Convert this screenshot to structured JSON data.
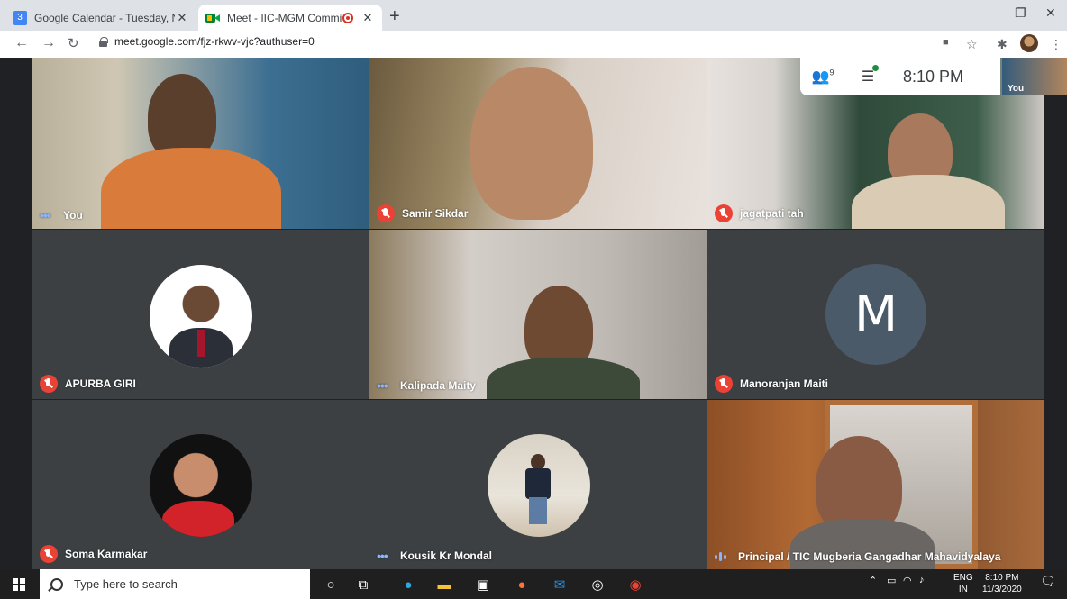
{
  "browser": {
    "tabs": [
      {
        "title": "Google Calendar - Tuesday, Nov",
        "favicon": "calendar-icon",
        "favicon_text": "3"
      },
      {
        "title": "Meet - IIC-MGM Committee",
        "favicon": "meet-icon",
        "recording": true
      }
    ],
    "url": "meet.google.com/fjz-rkwv-vjc?authuser=0",
    "new_tab": "+"
  },
  "meet": {
    "clock": "8:10 PM",
    "participants_badge": "9",
    "self_label": "You",
    "tiles": [
      {
        "name": "You",
        "state": "speaking-dots"
      },
      {
        "name": "Samir Sikdar",
        "state": "muted"
      },
      {
        "name": "jagatpati tah",
        "state": "muted"
      },
      {
        "name": "APURBA GIRI",
        "state": "muted"
      },
      {
        "name": "Kalipada Maity",
        "state": "speaking-dots"
      },
      {
        "name": "Manoranjan Maiti",
        "state": "muted",
        "initial": "M"
      },
      {
        "name": "Soma Karmakar",
        "state": "muted"
      },
      {
        "name": "Kousik Kr Mondal",
        "state": "speaking-dots"
      },
      {
        "name": "Principal / TIC Mugberia Gangadhar Mahavidyalaya",
        "state": "speaking"
      }
    ]
  },
  "taskbar": {
    "search_placeholder": "Type here to search",
    "lang_top": "ENG",
    "lang_bottom": "IN",
    "time": "8:10 PM",
    "date": "11/3/2020"
  },
  "colors": {
    "muted": "#ea4335",
    "speaking": "#8ab4f8",
    "meet_bg": "#202124",
    "avatar_bg": "#4a5a68"
  }
}
